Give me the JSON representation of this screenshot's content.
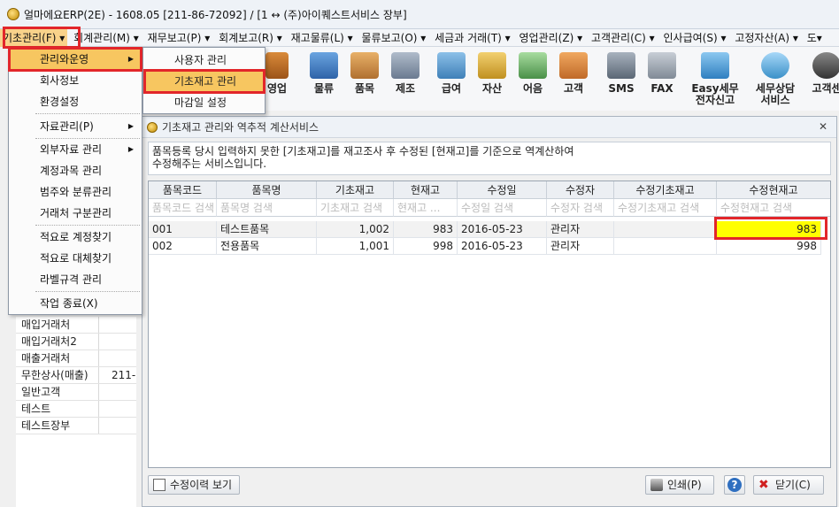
{
  "window": {
    "title": "얼마에요ERP(2E) - 1608.05 [211-86-72092] / [1 ↔ (주)아이퀘스트서비스 장부]"
  },
  "menubar": [
    "기초관리(F) ▾",
    "회계관리(M) ▾",
    "재무보고(P) ▾",
    "회계보고(R) ▾",
    "재고물류(L) ▾",
    "물류보고(O) ▾",
    "세금과 거래(T) ▾",
    "영업관리(Z) ▾",
    "고객관리(C) ▾",
    "인사급여(S) ▾",
    "고정자산(A) ▾",
    "도▾"
  ],
  "toolbar": [
    {
      "label": "영업",
      "icon": "briefcase-icon",
      "color": "#b46a2a"
    },
    {
      "label": "물류",
      "icon": "truck-icon",
      "color": "#3b78c2"
    },
    {
      "label": "품목",
      "icon": "boxes-icon",
      "color": "#c9883a"
    },
    {
      "label": "제조",
      "icon": "tools-icon",
      "color": "#7a8aa0"
    },
    {
      "label": "급여",
      "icon": "id-card-icon",
      "color": "#4a90c8"
    },
    {
      "label": "자산",
      "icon": "coins-icon",
      "color": "#d8a830"
    },
    {
      "label": "어음",
      "icon": "bill-icon",
      "color": "#58a058"
    },
    {
      "label": "고객",
      "icon": "people-icon",
      "color": "#d07a30"
    },
    {
      "label": "SMS",
      "icon": "phone-icon",
      "color": "#6b7785"
    },
    {
      "label": "FAX",
      "icon": "fax-icon",
      "color": "#8a94a0"
    },
    {
      "label": "Easy세무\n전자신고",
      "icon": "tax-doc-icon",
      "color": "#3d8fd0"
    },
    {
      "label": "세무상담\n서비스",
      "icon": "chat-icon",
      "color": "#4aa0d8"
    },
    {
      "label": "고객센",
      "icon": "headset-icon",
      "color": "#555"
    }
  ],
  "dropdown": {
    "items": [
      "관리와운영",
      "회사정보",
      "환경설정",
      "자료관리(P)",
      "외부자료 관리",
      "계정과목 관리",
      "범주와 분류관리",
      "거래처 구분관리",
      "적요로 계정찾기",
      "적요로 대체찾기",
      "라벨규격 관리",
      "작업 종료(X)"
    ]
  },
  "submenu": {
    "items": [
      "사용자 관리",
      "기초재고 관리",
      "마감일 설정"
    ]
  },
  "leftlist": [
    {
      "a": "매입거래처",
      "b": ""
    },
    {
      "a": "매입거래처2",
      "b": ""
    },
    {
      "a": "매출거래처",
      "b": ""
    },
    {
      "a": "무한상사(매출)",
      "b": "211-"
    },
    {
      "a": "일반고객",
      "b": ""
    },
    {
      "a": "테스트",
      "b": ""
    },
    {
      "a": "테스트장부",
      "b": ""
    }
  ],
  "dialog": {
    "title": "기초재고 관리와 역추적 계산서비스",
    "notice_line1": "품목등록 당시 입력하지 못한 [기초재고]를 재고조사 후 수정된 [현재고]를 기준으로 역계산하여",
    "notice_line2": "수정해주는 서비스입니다.",
    "columns": [
      "품목코드",
      "품목명",
      "기초재고",
      "현재고",
      "수정일",
      "수정자",
      "수정기초재고",
      "수정현재고"
    ],
    "filters": [
      "품목코드 검색",
      "품목명 검색",
      "기초재고 검색",
      "현재고 ...",
      "수정일 검색",
      "수정자 검색",
      "수정기초재고 검색",
      "수정현재고 검색"
    ],
    "rows": [
      {
        "code": "001",
        "name": "테스트품목",
        "base": "1,002",
        "current": "983",
        "date": "2016-05-23",
        "editor": "관리자",
        "edit_base": "",
        "edit_current": "983"
      },
      {
        "code": "002",
        "name": "전용품목",
        "base": "1,001",
        "current": "998",
        "date": "2016-05-23",
        "editor": "관리자",
        "edit_base": "",
        "edit_current": "998"
      }
    ],
    "buttons": {
      "history": "수정이력 보기",
      "print": "인쇄(P)",
      "help": "?",
      "close": "닫기(C)"
    }
  },
  "colors": {
    "highlight": "#ffff00",
    "menu_selected": "#f7c660",
    "annotation": "#e2262a"
  }
}
